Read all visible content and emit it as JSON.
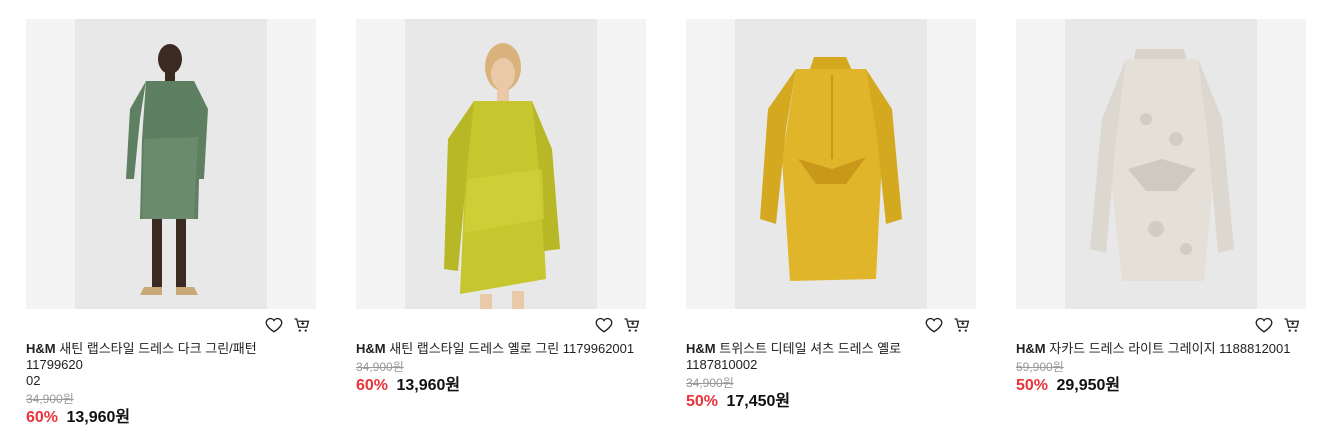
{
  "products": [
    {
      "brand": "H&M",
      "name": "새틴 랩스타일 드레스 다크 그린/패턴 11799620",
      "name_line2": "02",
      "original_price": "34,900원",
      "discount": "60%",
      "price": "13,960원",
      "image": "green-patterned-wrap-dress-on-model"
    },
    {
      "brand": "H&M",
      "name": "새틴 랩스타일 드레스 옐로 그린 1179962001",
      "name_line2": "",
      "original_price": "34,900원",
      "discount": "60%",
      "price": "13,960원",
      "image": "yellow-green-satin-wrap-dress-on-model"
    },
    {
      "brand": "H&M",
      "name": "트위스트 디테일 셔츠 드레스 옐로 1187810002",
      "name_line2": "",
      "original_price": "34,900원",
      "discount": "50%",
      "price": "17,450원",
      "image": "yellow-twist-shirt-dress"
    },
    {
      "brand": "H&M",
      "name": "자카드 드레스 라이트 그레이지 1188812001",
      "name_line2": "",
      "original_price": "59,900원",
      "discount": "50%",
      "price": "29,950원",
      "image": "light-greige-jacquard-dress"
    }
  ],
  "icons": {
    "wishlist": "heart-icon",
    "cart": "cart-icon"
  },
  "colors": {
    "discount": "#e8343a",
    "strike": "#999999",
    "image_bg": "#f4f4f4"
  }
}
